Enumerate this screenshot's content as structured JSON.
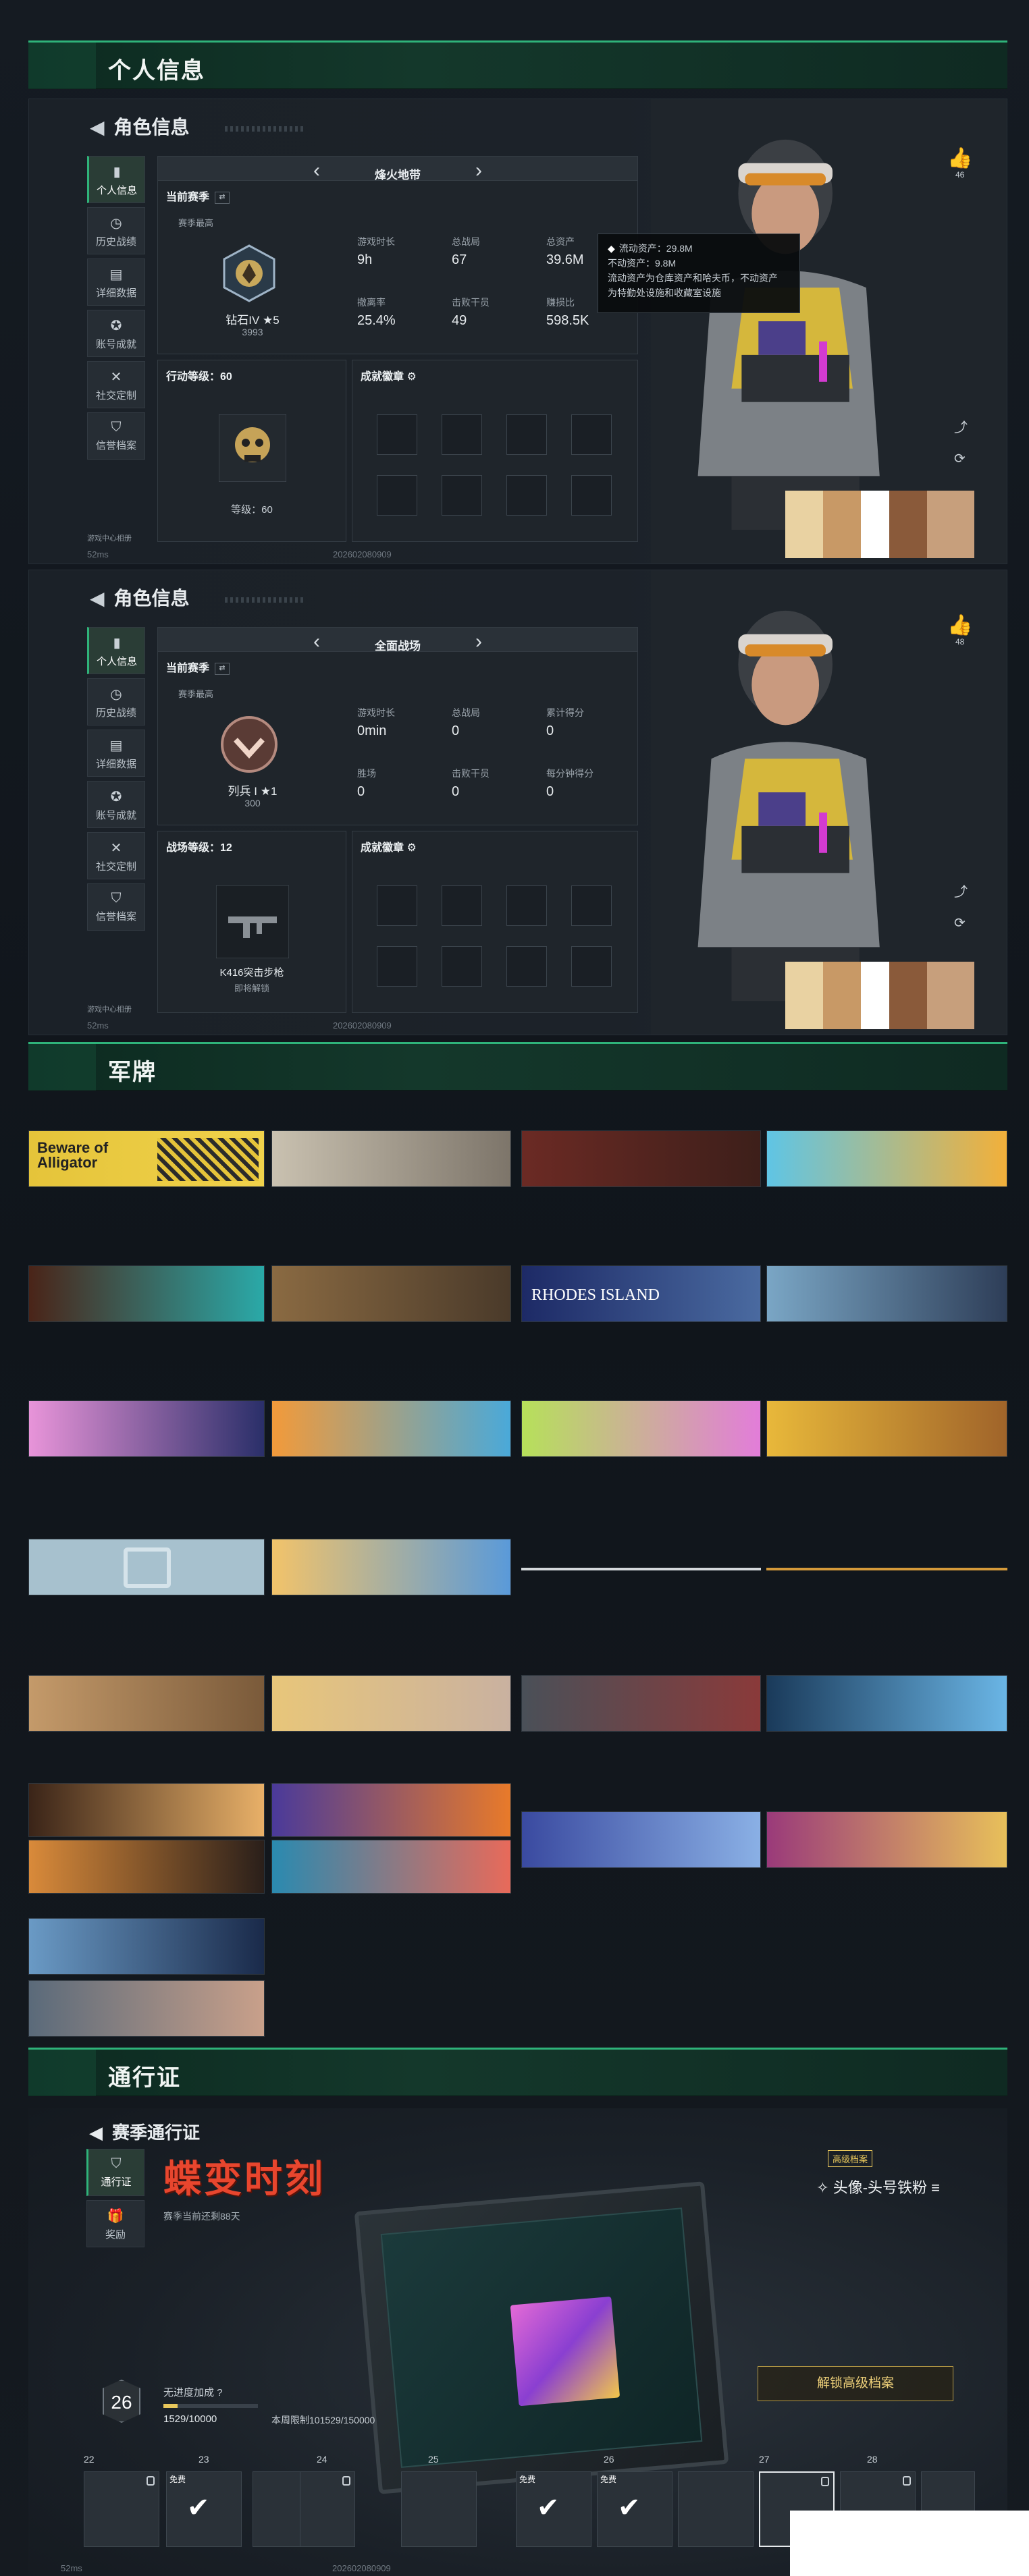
{
  "sections": {
    "personal": "个人信息",
    "plates": "军牌",
    "pass": "通行证"
  },
  "role_panel": {
    "back_title": "角色信息",
    "nav": [
      {
        "label": "个人信息",
        "icon": "bar-chart-icon"
      },
      {
        "label": "历史战绩",
        "icon": "history-icon"
      },
      {
        "label": "详细数据",
        "icon": "data-icon"
      },
      {
        "label": "账号成就",
        "icon": "medal-icon"
      },
      {
        "label": "社交定制",
        "icon": "tools-icon"
      },
      {
        "label": "信誉档案",
        "icon": "shield-icon"
      }
    ],
    "status_text": "游戏中心相册",
    "signal": "52ms",
    "signature": "202602080909",
    "likes": "46"
  },
  "panel1": {
    "mode": "烽火地带",
    "current_season": "当前赛季",
    "season_best": "赛季最高",
    "rank_name": "钻石IV",
    "rank_stars": "5",
    "rank_score": "3993",
    "stats": [
      {
        "k": "游戏时长",
        "v": "9h"
      },
      {
        "k": "总战局",
        "v": "67"
      },
      {
        "k": "总资产",
        "v": "39.6M"
      },
      {
        "k": "撤离率",
        "v": "25.4%"
      },
      {
        "k": "击败干员",
        "v": "49"
      },
      {
        "k": "赚损比",
        "v": "598.5K"
      }
    ],
    "tooltip": {
      "line1": "流动资产：29.8M",
      "line2": "不动资产：9.8M",
      "line3": "流动资产为仓库资产和哈夫币，不动资产",
      "line4": "为特勤处设施和收藏室设施"
    },
    "action_level": "行动等级：60",
    "level_text": "等级：60",
    "achievements": "成就徽章"
  },
  "panel2": {
    "mode": "全面战场",
    "current_season": "当前赛季",
    "season_best": "赛季最高",
    "rank_name": "列兵 I",
    "rank_stars": "1",
    "rank_score": "300",
    "stats": [
      {
        "k": "游戏时长",
        "v": "0min"
      },
      {
        "k": "总战局",
        "v": "0"
      },
      {
        "k": "累计得分",
        "v": "0"
      },
      {
        "k": "胜场",
        "v": "0"
      },
      {
        "k": "击败干员",
        "v": "0"
      },
      {
        "k": "每分钟得分",
        "v": "0"
      }
    ],
    "battle_level": "战场等级：12",
    "weapon_name": "K416突击步枪",
    "weapon_sub": "即将解锁",
    "achievements": "成就徽章",
    "likes": "48"
  },
  "plates": {
    "beware_title": "Beware of Alligator",
    "rhodes": "RHODES ISLAND"
  },
  "pass": {
    "back_title": "赛季通行证",
    "nav": [
      {
        "label": "通行证",
        "icon": "pass-icon"
      },
      {
        "label": "奖励",
        "icon": "gift-icon"
      }
    ],
    "title": "蝶变时刻",
    "sub": "赛季当前还剩88天",
    "tag": "高级档案",
    "reward": "头像-头号铁粉",
    "unlock": "解锁高级档案",
    "level": "26",
    "no_bonus": "无进度加成",
    "progress_text": "1529/10000",
    "progress_fraction": 0.153,
    "week_text": "本周限制101529/150000",
    "ticks": [
      "22",
      "23",
      "24",
      "25",
      "26",
      "27",
      "28"
    ],
    "free": "免费",
    "signal": "52ms",
    "signature": "202602080909"
  }
}
